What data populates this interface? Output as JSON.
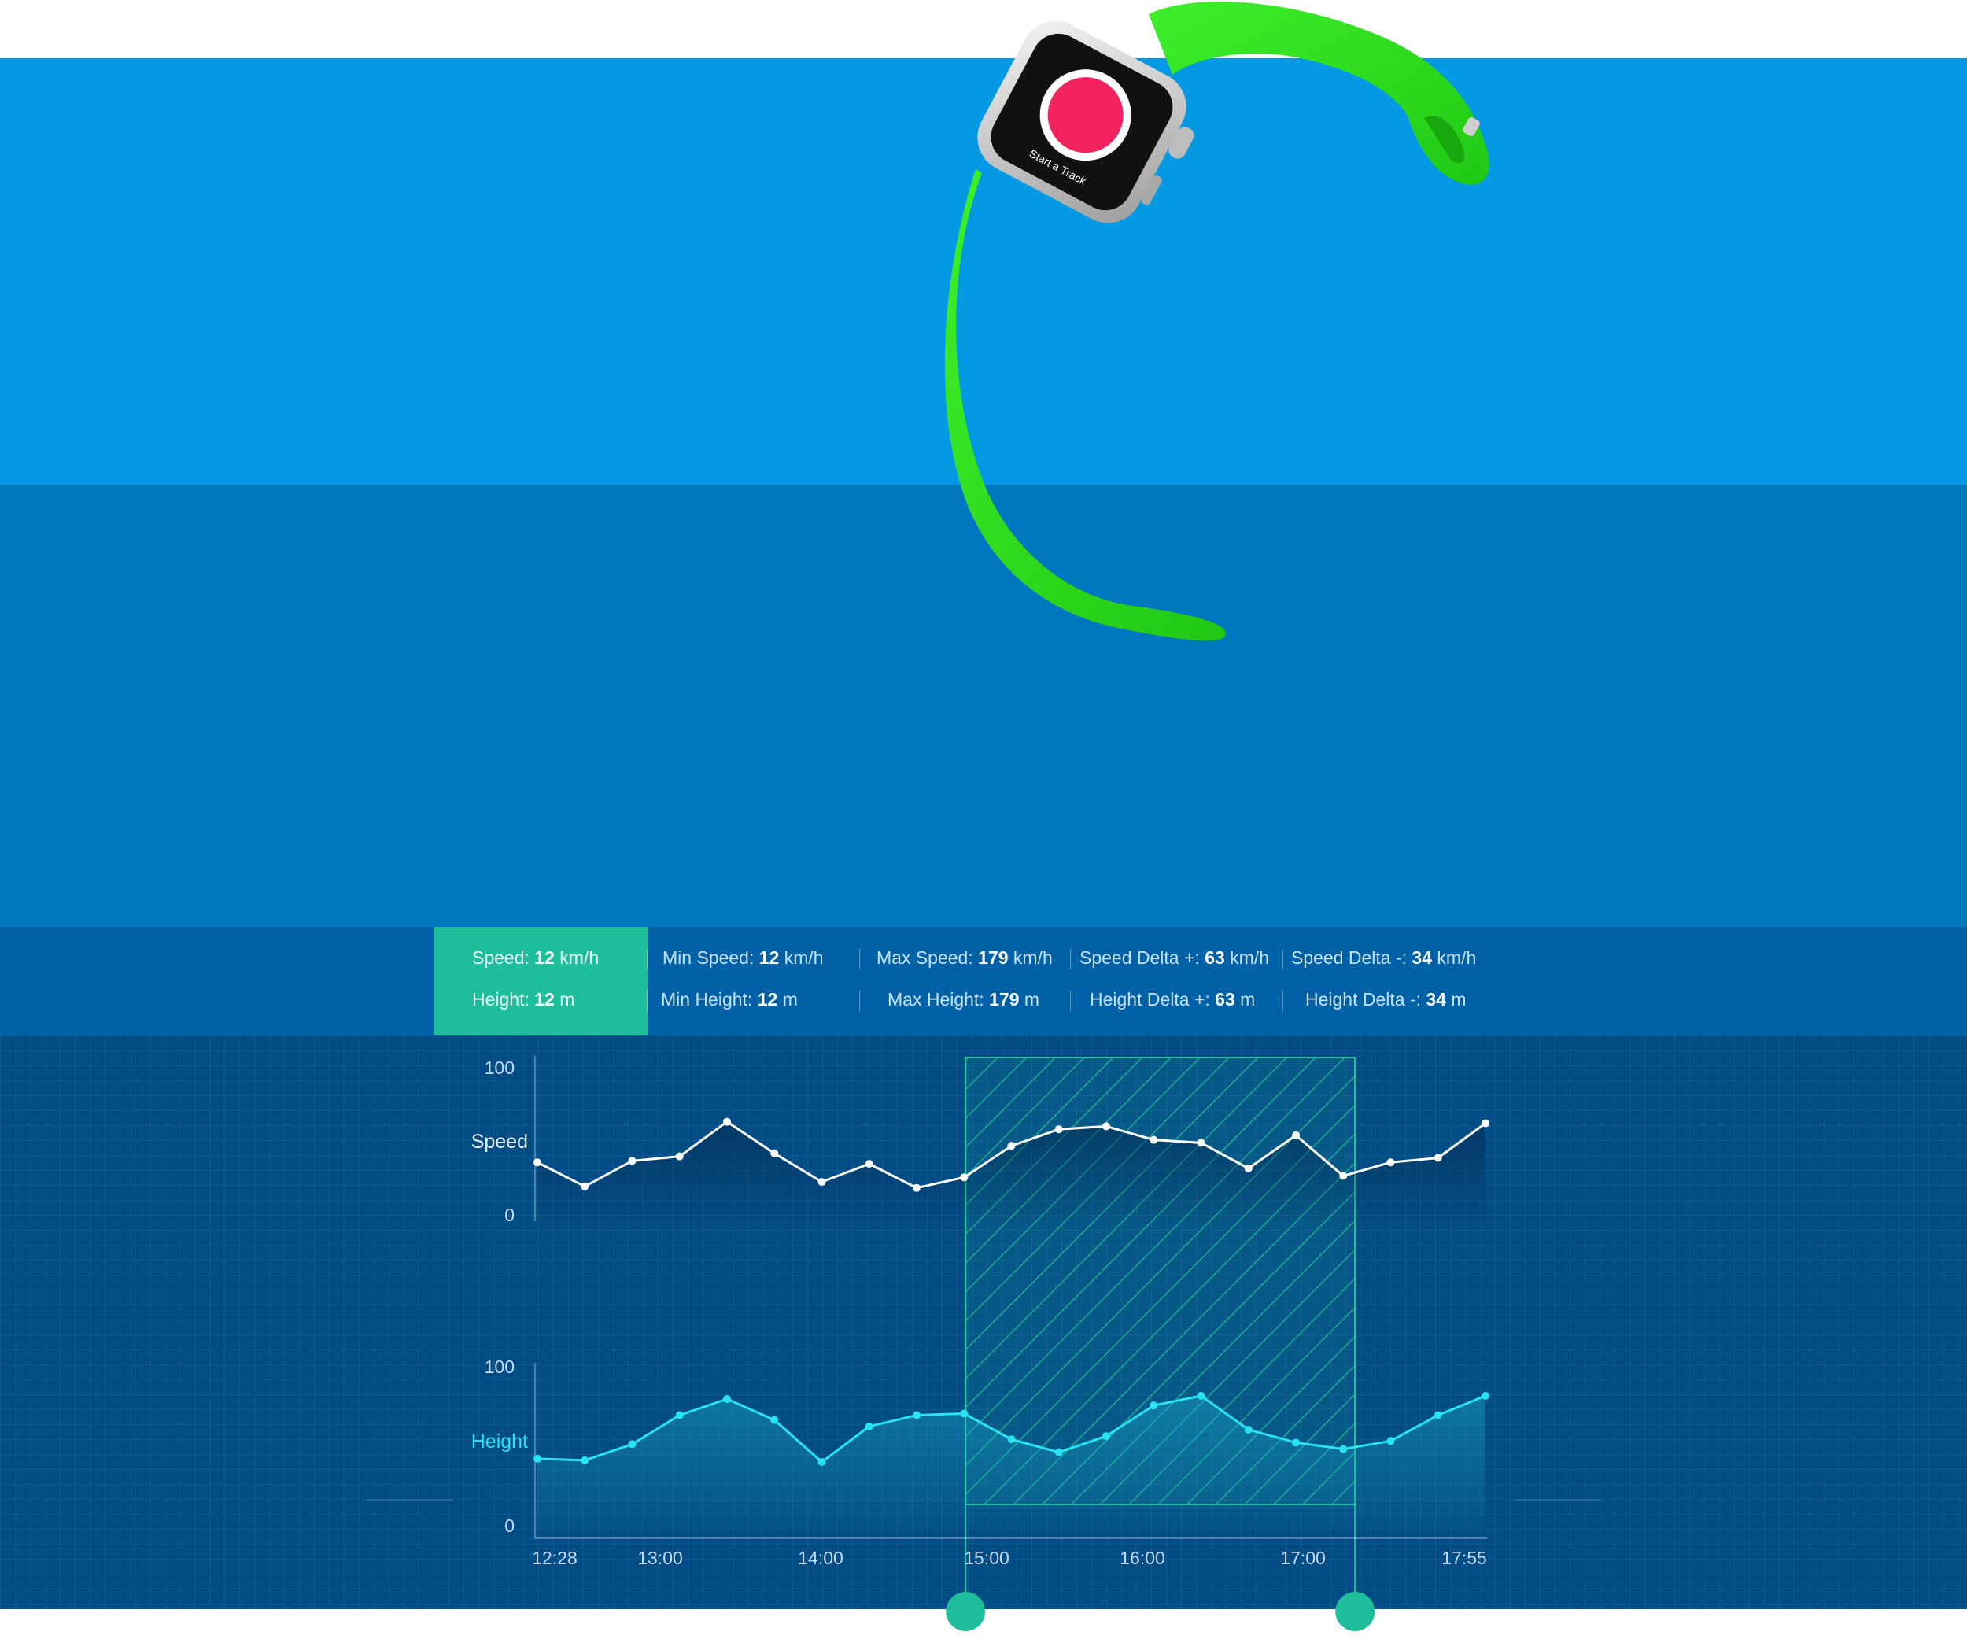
{
  "watch": {
    "screen_label": "Start a Track",
    "band_color": "#2ee01a",
    "accent_color": "#f2235f"
  },
  "stats": {
    "row1": [
      {
        "label": "Speed: ",
        "value": "12",
        "unit": " km/h",
        "active": true
      },
      {
        "label": "Min Speed: ",
        "value": "12",
        "unit": " km/h"
      },
      {
        "label": "Max Speed: ",
        "value": "179",
        "unit": " km/h"
      },
      {
        "label": "Speed Delta +: ",
        "value": "63",
        "unit": " km/h"
      },
      {
        "label": "Speed Delta -: ",
        "value": "34",
        "unit": " km/h"
      }
    ],
    "row2": [
      {
        "label": "Height: ",
        "value": "12",
        "unit": " m",
        "active": true
      },
      {
        "label": "Min Height: ",
        "value": "12",
        "unit": " m"
      },
      {
        "label": "Max Height: ",
        "value": "179",
        "unit": " m"
      },
      {
        "label": "Height Delta +: ",
        "value": "63",
        "unit": " m"
      },
      {
        "label": "Height Delta -: ",
        "value": "34",
        "unit": " m"
      }
    ]
  },
  "chart_data": {
    "type": "line",
    "x_ticks": [
      "12:28",
      "13:00",
      "14:00",
      "15:00",
      "16:00",
      "17:00",
      "17:55"
    ],
    "series": [
      {
        "name": "Speed",
        "ylim": [
          0,
          100
        ],
        "y_ticks": [
          "0",
          "100"
        ],
        "color": "#ffffff",
        "values": [
          36,
          20,
          37,
          40,
          63,
          42,
          23,
          35,
          19,
          26,
          47,
          58,
          60,
          51,
          49,
          32,
          54,
          27,
          36,
          39,
          62
        ]
      },
      {
        "name": "Height",
        "ylim": [
          0,
          100
        ],
        "y_ticks": [
          "0",
          "100"
        ],
        "color": "#27e3f3",
        "values": [
          43,
          42,
          52,
          70,
          80,
          67,
          41,
          63,
          70,
          71,
          55,
          47,
          57,
          76,
          82,
          61,
          53,
          49,
          54,
          70,
          82
        ]
      }
    ],
    "selection": {
      "from_index": 9,
      "to_index": 17
    },
    "grid": true
  },
  "colors": {
    "band_top": "#0499e3",
    "band_mid": "#0276bf",
    "stats_bar": "#0161a6",
    "chart_bg": "#034d86",
    "selection": "#20c79d"
  }
}
